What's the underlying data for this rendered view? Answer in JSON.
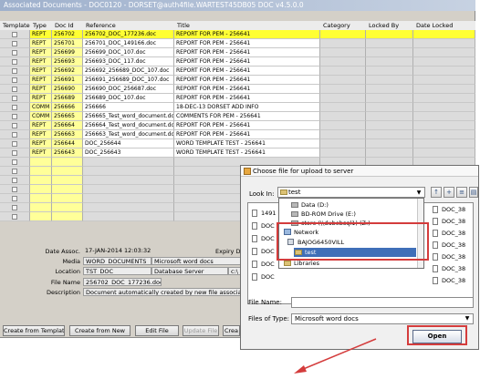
{
  "main_window": {
    "title": "Associated Documents - DOC0120 - DORSET@auth4file.WARTEST45DB05 DOC v4.5.0.0"
  },
  "grid": {
    "columns": [
      "Template",
      "Type",
      "Doc Id",
      "Reference",
      "Title",
      "Category",
      "Locked By",
      "Date Locked"
    ],
    "rows": [
      {
        "type": "REPT",
        "doc_id": "256702",
        "reference": "256702_DOC_177236.doc",
        "title": "REPORT FOR PEM - 256641",
        "selected": true
      },
      {
        "type": "REPT",
        "doc_id": "256701",
        "reference": "256701_DOC_149166.doc",
        "title": "REPORT FOR PEM - 256641",
        "selected": false
      },
      {
        "type": "REPT",
        "doc_id": "256699",
        "reference": "256699_DOC_107.doc",
        "title": "REPORT FOR PEM - 256641",
        "selected": false
      },
      {
        "type": "REPT",
        "doc_id": "256693",
        "reference": "256693_DOC_117.doc",
        "title": "REPORT FOR PEM - 256641",
        "selected": false
      },
      {
        "type": "REPT",
        "doc_id": "256692",
        "reference": "256692_256689_DOC_107.doc",
        "title": "REPORT FOR PEM - 256641",
        "selected": false
      },
      {
        "type": "REPT",
        "doc_id": "256691",
        "reference": "256691_256689_DOC_107.doc",
        "title": "REPORT FOR PEM - 256641",
        "selected": false
      },
      {
        "type": "REPT",
        "doc_id": "256690",
        "reference": "256690_DOC_256687.doc",
        "title": "REPORT FOR PEM - 256641",
        "selected": false
      },
      {
        "type": "REPT",
        "doc_id": "256689",
        "reference": "256689_DOC_107.doc",
        "title": "REPORT FOR PEM - 256641",
        "selected": false
      },
      {
        "type": "COMM",
        "doc_id": "256666",
        "reference": "256666",
        "title": "18-DEC-13 DORSET ADD INFO",
        "selected": false
      },
      {
        "type": "COMM",
        "doc_id": "256665",
        "reference": "256665_Test_word_document.doc",
        "title": "COMMENTS FOR PEM - 256641",
        "selected": false
      },
      {
        "type": "REPT",
        "doc_id": "256664",
        "reference": "256664_Test_word_document.doc",
        "title": "REPORT FOR PEM - 256641",
        "selected": false
      },
      {
        "type": "REPT",
        "doc_id": "256663",
        "reference": "256663_Test_word_document.doc",
        "title": "REPORT FOR PEM - 256641",
        "selected": false
      },
      {
        "type": "REPT",
        "doc_id": "256644",
        "reference": "DOC_256644",
        "title": "WORD TEMPLATE TEST - 256641",
        "selected": false
      },
      {
        "type": "REPT",
        "doc_id": "256643",
        "reference": "DOC_256643",
        "title": "WORD TEMPLATE TEST - 256641",
        "selected": false
      }
    ]
  },
  "details": {
    "date_assoc_label": "Date Assoc.",
    "date_assoc_value": "17-JAN-2014 12:03:32",
    "expiry_label": "Expiry Date",
    "media_label": "Media",
    "media_value": "WORD_DOCUMENTS",
    "media_desc": "Microsoft word docs",
    "location_label": "Location",
    "location_value": "TST_DOC",
    "location_desc": "Database Server",
    "location_path": "c:\\",
    "filename_label": "File Name",
    "filename_value": "256702_DOC_177236.doc",
    "description_label": "Description",
    "description_value": "Document automatically created by new file association"
  },
  "buttons": {
    "create_from_template": "Create from Template",
    "create_from_new": "Create from New",
    "edit_file": "Edit File",
    "update_file": "Update File",
    "create_partial": "Crea"
  },
  "dialog": {
    "title": "Choose file for upload to server",
    "look_in_label": "Look In:",
    "look_in_value": "test",
    "file_list_left": [
      "1491",
      "DOC",
      "DOC",
      "DOC",
      "DOC",
      "DOC"
    ],
    "file_list_right": [
      "DOC_38",
      "DOC_38",
      "DOC_38",
      "DOC_38",
      "DOC_38",
      "DOC_38",
      "DOC_38"
    ],
    "dropdown_items": [
      {
        "label": "Data (D:)",
        "icon": "drive-icon"
      },
      {
        "label": "BD-ROM Drive (E:)",
        "icon": "drive-icon"
      },
      {
        "label": "store (\\\\dubebsql1) (Z:)",
        "icon": "drive-icon"
      },
      {
        "label": "Network",
        "icon": "network-icon"
      },
      {
        "label": "BAJOG6450VILL",
        "icon": "computer-icon"
      },
      {
        "label": "test",
        "icon": "folder-icon"
      },
      {
        "label": "Libraries",
        "icon": "folder-icon"
      }
    ],
    "file_name_label": "File Name:",
    "file_name_value": "",
    "file_type_label": "Files of Type:",
    "file_type_value": "Microsoft word docs",
    "open_button": "Open"
  },
  "colors": {
    "selected_row": "#ffff33",
    "highlight": "#d43c3c",
    "dropdown_selected": "#3f6fb8"
  }
}
